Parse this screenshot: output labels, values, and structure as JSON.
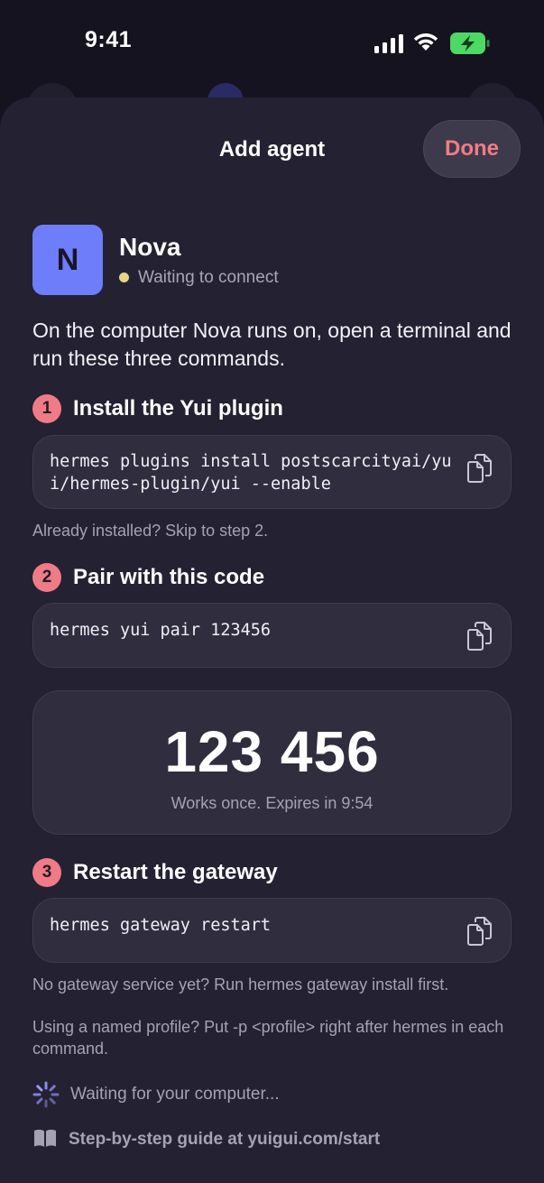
{
  "status_bar": {
    "time": "9:41"
  },
  "sheet": {
    "title": "Add agent",
    "done_label": "Done"
  },
  "agent": {
    "initial": "N",
    "name": "Nova",
    "status": "Waiting to connect",
    "status_color": "#e8d48a",
    "avatar_color": "#6e7dfa"
  },
  "intro": "On the computer Nova runs on, open a terminal and run these three commands.",
  "steps": [
    {
      "number": "1",
      "title": "Install the Yui plugin",
      "command": "hermes plugins install postscarcityai/yui/hermes-plugin/yui --enable",
      "note": "Already installed? Skip to step 2."
    },
    {
      "number": "2",
      "title": "Pair with this code",
      "command": "hermes yui pair 123456"
    },
    {
      "number": "3",
      "title": "Restart the gateway",
      "command": "hermes gateway restart",
      "note": "No gateway service yet? Run hermes gateway install first."
    }
  ],
  "pair_code": {
    "code": "123 456",
    "expiry": "Works once. Expires in 9:54"
  },
  "profile_note": "Using a named profile? Put -p <profile> right after hermes in each command.",
  "waiting": "Waiting for your computer...",
  "guide": "Step-by-step guide at yuigui.com/start",
  "colors": {
    "accent": "#ef7b86",
    "sheet": "#242133",
    "card": "#302d3f"
  }
}
